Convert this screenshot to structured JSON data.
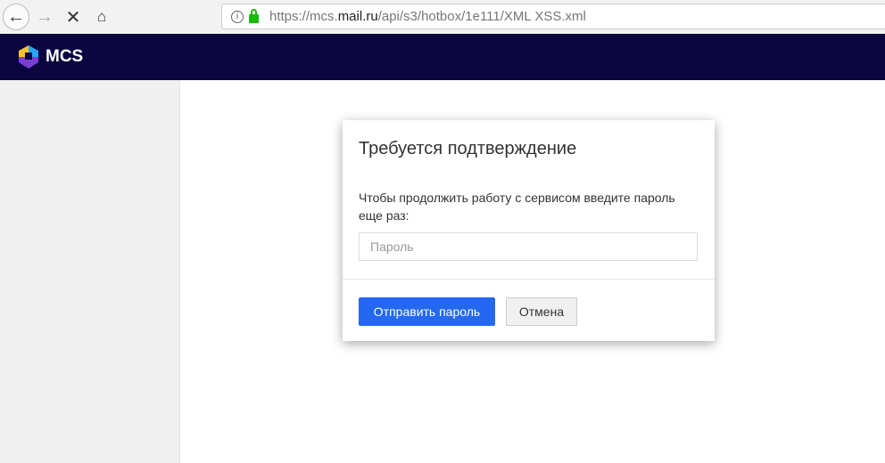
{
  "browser": {
    "url_prefix": "https://mcs.",
    "url_domain": "mail.ru",
    "url_path": "/api/s3/hotbox/1e111/XML XSS.xml"
  },
  "header": {
    "logo_text": "MCS"
  },
  "dialog": {
    "title": "Требуется подтверждение",
    "message": "Чтобы продолжить работу с сервисом введите пароль еще раз:",
    "password_placeholder": "Пароль",
    "password_value": "",
    "submit_label": "Отправить пароль",
    "cancel_label": "Отмена"
  },
  "colors": {
    "header_bg": "#0b0540",
    "primary": "#2468f2"
  }
}
